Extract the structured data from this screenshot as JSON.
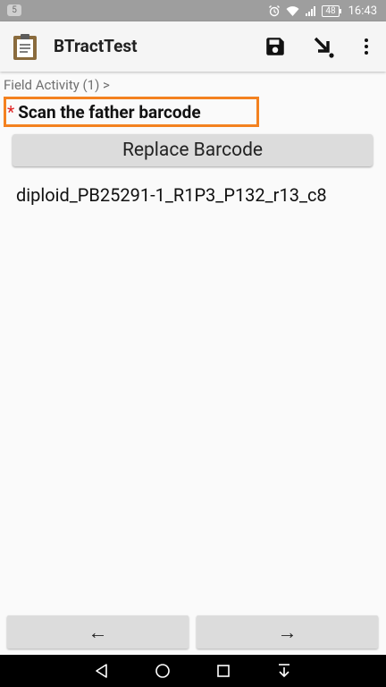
{
  "status_bar": {
    "notification_count": "5",
    "battery": "48",
    "time": "16:43",
    "icons": [
      "alarm-icon",
      "wifi-icon",
      "signal-icon",
      "battery-icon"
    ]
  },
  "app_bar": {
    "title": "BTractTest",
    "icons": [
      "clipboard-icon",
      "save-icon",
      "jump-icon",
      "more-vert-icon"
    ]
  },
  "breadcrumb": "Field Activity (1) >",
  "question": {
    "required_marker": "*",
    "label": "Scan the father barcode"
  },
  "replace_button_label": "Replace Barcode",
  "barcode_value": "diploid_PB25291-1_R1P3_P132_r13_c8",
  "nav_buttons": {
    "back": "←",
    "forward": "→"
  },
  "colors": {
    "highlight": "#f3811f",
    "required": "#e02424",
    "status_bar": "#9e9e9e"
  }
}
